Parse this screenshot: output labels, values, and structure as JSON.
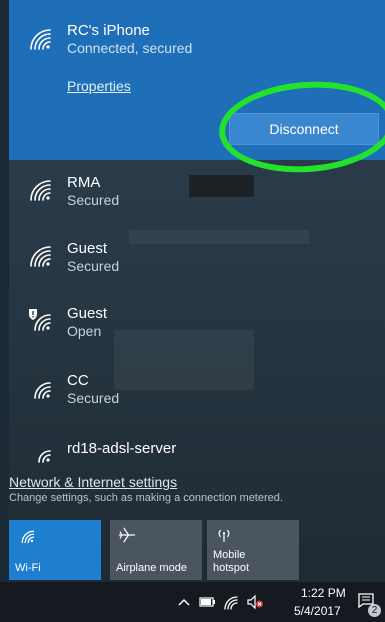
{
  "connected_network": {
    "name": "RC's iPhone",
    "status": "Connected, secured",
    "properties_label": "Properties",
    "disconnect_label": "Disconnect",
    "icon": "wifi-icon"
  },
  "networks": [
    {
      "name": "RMA",
      "status": "Secured",
      "icon": "wifi-icon"
    },
    {
      "name": "Guest",
      "status": "Secured",
      "icon": "wifi-icon"
    },
    {
      "name": "Guest",
      "status": "Open",
      "icon": "wifi-shield-icon"
    },
    {
      "name": "CC",
      "status": "Secured",
      "icon": "wifi-icon"
    },
    {
      "name": "rd18-adsl-server",
      "status": "",
      "icon": "wifi-icon"
    }
  ],
  "settings": {
    "link": "Network & Internet settings",
    "description": "Change settings, such as making a connection metered."
  },
  "tiles": [
    {
      "label": "Wi-Fi",
      "icon": "wifi-icon",
      "active": true
    },
    {
      "label": "Airplane mode",
      "icon": "airplane-icon",
      "active": false
    },
    {
      "label_line1": "Mobile",
      "label_line2": "hotspot",
      "icon": "hotspot-icon",
      "active": false
    }
  ],
  "taskbar": {
    "time": "1:22 PM",
    "date": "5/4/2017",
    "notification_count": "2"
  },
  "colors": {
    "accent": "#1f6fb8",
    "tile_active": "#1e7fd0",
    "highlight": "#22e22e"
  }
}
